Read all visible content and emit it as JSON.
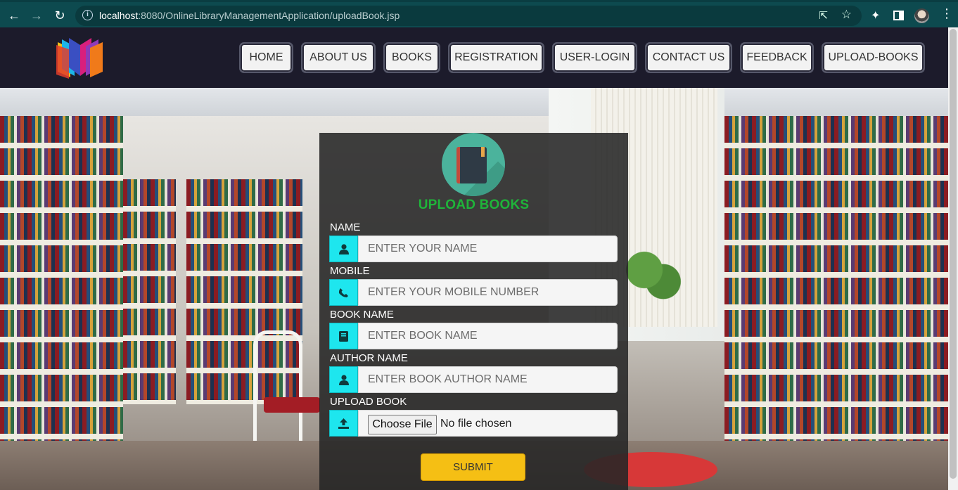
{
  "browser": {
    "url_host": "localhost",
    "url_rest": ":8080/OnlineLibraryManagementApplication/uploadBook.jsp",
    "icons": [
      "back-arrow-icon",
      "forward-arrow-icon",
      "reload-icon",
      "info-icon",
      "share-icon",
      "star-icon",
      "puzzle-icon",
      "side-panel-icon",
      "profile-avatar",
      "more-menu-icon"
    ]
  },
  "nav": {
    "items": [
      {
        "label": "HOME"
      },
      {
        "label": "ABOUT US"
      },
      {
        "label": "BOOKS"
      },
      {
        "label": "REGISTRATION"
      },
      {
        "label": "USER-LOGIN"
      },
      {
        "label": "CONTACT US"
      },
      {
        "label": "FEEDBACK"
      },
      {
        "label": "UPLOAD-BOOKS"
      }
    ]
  },
  "form": {
    "title": "UPLOAD BOOKS",
    "fields": [
      {
        "label": "NAME",
        "placeholder": "ENTER YOUR NAME",
        "icon": "user-icon"
      },
      {
        "label": "MOBILE",
        "placeholder": "ENTER YOUR MOBILE NUMBER",
        "icon": "phone-icon"
      },
      {
        "label": "BOOK NAME",
        "placeholder": "ENTER BOOK NAME",
        "icon": "book-icon"
      },
      {
        "label": "AUTHOR NAME",
        "placeholder": "ENTER BOOK AUTHOR NAME",
        "icon": "user-icon"
      }
    ],
    "upload": {
      "label": "UPLOAD BOOK",
      "button": "Choose File",
      "status": "No file chosen",
      "icon": "upload-icon"
    },
    "submit": "SUBMIT"
  },
  "colors": {
    "header_bg": "#1c1b2b",
    "accent_cyan": "#1ee6ee",
    "title_green": "#1fb43a",
    "submit_yellow": "#f5bf14"
  }
}
